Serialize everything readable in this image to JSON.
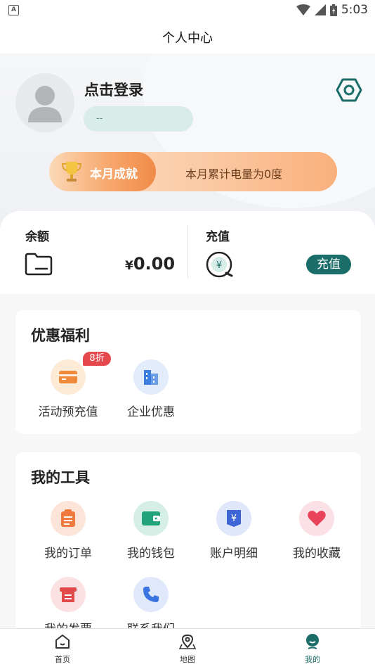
{
  "status_bar": {
    "indicator": "A",
    "time": "5:03"
  },
  "header": {
    "title": "个人中心"
  },
  "profile": {
    "login_label": "点击登录",
    "subtitle": "--",
    "settings_icon": "hexagon-settings-icon"
  },
  "achievement": {
    "title": "本月成就",
    "text": "本月累计电量为0度"
  },
  "balance": {
    "label": "余额",
    "currency": "¥",
    "amount": "0.00"
  },
  "recharge": {
    "label": "充值",
    "button_label": "充值"
  },
  "benefits": {
    "title": "优惠福利",
    "items": [
      {
        "label": "活动预充值",
        "badge": "8折",
        "icon": "card-icon",
        "color": "#f7a24a"
      },
      {
        "label": "企业优惠",
        "icon": "building-icon",
        "color": "#3d7fe0"
      }
    ]
  },
  "tools": {
    "title": "我的工具",
    "items": [
      {
        "label": "我的订单",
        "icon": "clipboard-icon",
        "color": "#f07a3e"
      },
      {
        "label": "我的钱包",
        "icon": "wallet-icon",
        "color": "#23a37c"
      },
      {
        "label": "账户明细",
        "icon": "bill-icon",
        "color": "#3e65d6"
      },
      {
        "label": "我的收藏",
        "icon": "heart-icon",
        "color": "#e8435a"
      },
      {
        "label": "我的发票",
        "icon": "invoice-icon",
        "color": "#e04a4a"
      },
      {
        "label": "联系我们",
        "icon": "phone-icon",
        "color": "#3a74e0"
      }
    ]
  },
  "tabbar": {
    "items": [
      {
        "label": "首页",
        "icon": "home-icon"
      },
      {
        "label": "地图",
        "icon": "map-pin-icon"
      },
      {
        "label": "我的",
        "icon": "profile-icon",
        "active": true
      }
    ],
    "accent": "#1a6d68"
  }
}
